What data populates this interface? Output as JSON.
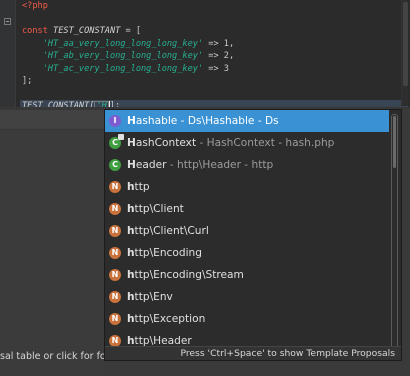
{
  "editor": {
    "lines": [
      {
        "parts": [
          {
            "cls": "kw",
            "text": "<?php"
          }
        ]
      },
      {
        "parts": []
      },
      {
        "parts": [
          {
            "cls": "kw",
            "text": "const "
          },
          {
            "cls": "const",
            "text": "TEST_CONSTANT"
          },
          {
            "cls": "op",
            "text": " = ["
          }
        ]
      },
      {
        "parts": [
          {
            "cls": "op",
            "text": "    "
          },
          {
            "cls": "str",
            "text": "'HT_aa_very_long_long_long_key'"
          },
          {
            "cls": "op",
            "text": " => "
          },
          {
            "cls": "num",
            "text": "1,"
          }
        ]
      },
      {
        "parts": [
          {
            "cls": "op",
            "text": "    "
          },
          {
            "cls": "str",
            "text": "'HT_ab_very_long_long_long_key'"
          },
          {
            "cls": "op",
            "text": " => "
          },
          {
            "cls": "num",
            "text": "2,"
          }
        ]
      },
      {
        "parts": [
          {
            "cls": "op",
            "text": "    "
          },
          {
            "cls": "str",
            "text": "'HT_ac_very_long_long_long_key'"
          },
          {
            "cls": "op",
            "text": " => "
          },
          {
            "cls": "num",
            "text": "3"
          }
        ]
      },
      {
        "parts": [
          {
            "cls": "op",
            "text": "];"
          }
        ]
      },
      {
        "parts": []
      }
    ],
    "current_line": {
      "prefix": "TEST_CONSTANT[",
      "typed": "'H",
      "suffix": "];"
    }
  },
  "status": {
    "text": "sal table or click for focus"
  },
  "content_assist": {
    "items": [
      {
        "icon": "interface-icon",
        "badge": "I",
        "kind": "interface",
        "match": "H",
        "rest": "ashable - Ds\\Hashable - Ds",
        "detail": "",
        "selected": true
      },
      {
        "icon": "class-icon",
        "badge": "C",
        "kind": "class",
        "match": "H",
        "rest": "ashContext",
        "detail": " - HashContext - hash.php",
        "selected": false,
        "mini": true
      },
      {
        "icon": "class-icon",
        "badge": "C",
        "kind": "class",
        "match": "H",
        "rest": "eader",
        "detail": " - http\\Header - http",
        "selected": false
      },
      {
        "icon": "namespace-icon",
        "badge": "N",
        "kind": "namespace",
        "match": "h",
        "rest": "ttp",
        "detail": "",
        "selected": false
      },
      {
        "icon": "namespace-icon",
        "badge": "N",
        "kind": "namespace",
        "match": "h",
        "rest": "ttp\\Client",
        "detail": "",
        "selected": false
      },
      {
        "icon": "namespace-icon",
        "badge": "N",
        "kind": "namespace",
        "match": "h",
        "rest": "ttp\\Client\\Curl",
        "detail": "",
        "selected": false
      },
      {
        "icon": "namespace-icon",
        "badge": "N",
        "kind": "namespace",
        "match": "h",
        "rest": "ttp\\Encoding",
        "detail": "",
        "selected": false
      },
      {
        "icon": "namespace-icon",
        "badge": "N",
        "kind": "namespace",
        "match": "h",
        "rest": "ttp\\Encoding\\Stream",
        "detail": "",
        "selected": false
      },
      {
        "icon": "namespace-icon",
        "badge": "N",
        "kind": "namespace",
        "match": "h",
        "rest": "ttp\\Env",
        "detail": "",
        "selected": false
      },
      {
        "icon": "namespace-icon",
        "badge": "N",
        "kind": "namespace",
        "match": "h",
        "rest": "ttp\\Exception",
        "detail": "",
        "selected": false
      },
      {
        "icon": "namespace-icon",
        "badge": "N",
        "kind": "namespace",
        "match": "h",
        "rest": "ttp\\Header",
        "detail": "",
        "selected": false
      }
    ],
    "footer": "Press 'Ctrl+Space' to show Template Proposals"
  },
  "colors": {
    "selection": "#3a92d4",
    "keyword": "#f25a47",
    "string": "#27b092"
  }
}
